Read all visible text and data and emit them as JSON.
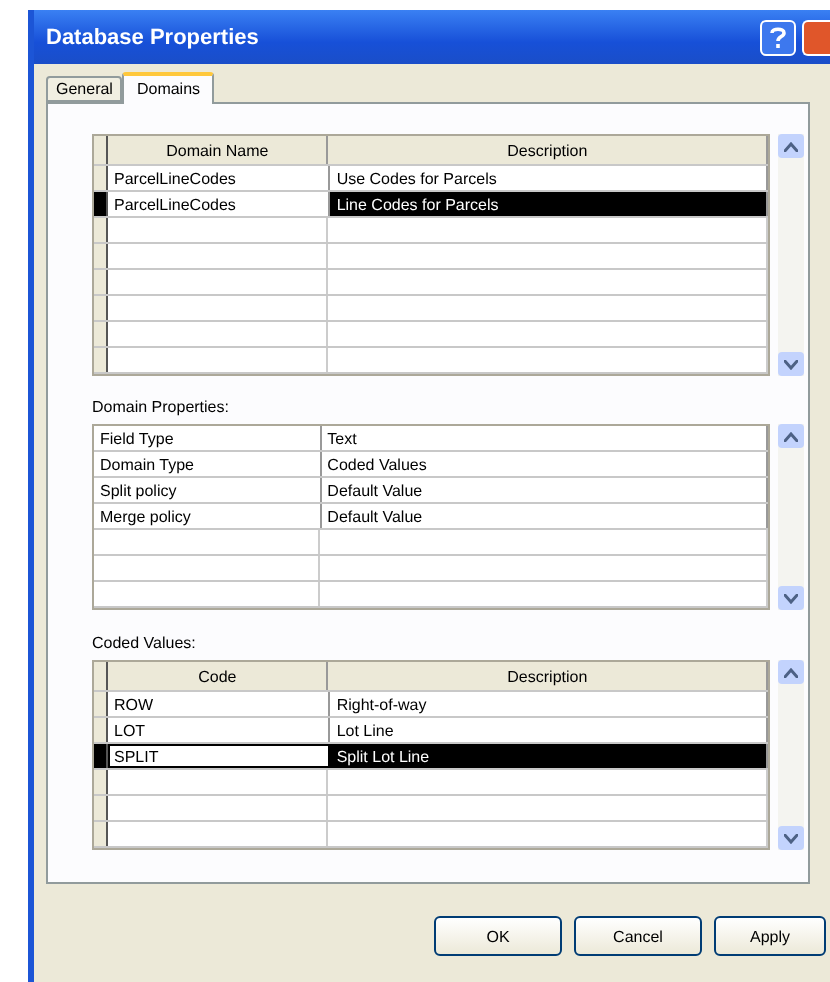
{
  "window": {
    "title": "Database Properties"
  },
  "tabs": [
    {
      "label": "General",
      "selected": false
    },
    {
      "label": "Domains",
      "selected": true
    }
  ],
  "domains_table": {
    "columns": [
      "Domain Name",
      "Description"
    ],
    "rows": [
      {
        "cells": [
          "ParcelLineCodes",
          "Use Codes for Parcels"
        ],
        "selected": false
      },
      {
        "cells": [
          "ParcelLineCodes",
          "Line Codes for Parcels"
        ],
        "selected": true
      }
    ]
  },
  "domain_properties": {
    "label": "Domain Properties:",
    "rows": [
      {
        "cells": [
          "Field Type",
          "Text"
        ]
      },
      {
        "cells": [
          "Domain Type",
          "Coded Values"
        ]
      },
      {
        "cells": [
          "Split policy",
          "Default Value"
        ]
      },
      {
        "cells": [
          "Merge policy",
          "Default Value"
        ]
      }
    ]
  },
  "coded_values": {
    "label": "Coded Values:",
    "columns": [
      "Code",
      "Description"
    ],
    "rows": [
      {
        "cells": [
          "ROW",
          "Right-of-way"
        ],
        "selected": false
      },
      {
        "cells": [
          "LOT",
          "Lot Line"
        ],
        "selected": false
      },
      {
        "cells": [
          "SPLIT",
          "Split Lot Line"
        ],
        "selected": true
      }
    ]
  },
  "buttons": [
    "OK",
    "Cancel",
    "Apply"
  ]
}
